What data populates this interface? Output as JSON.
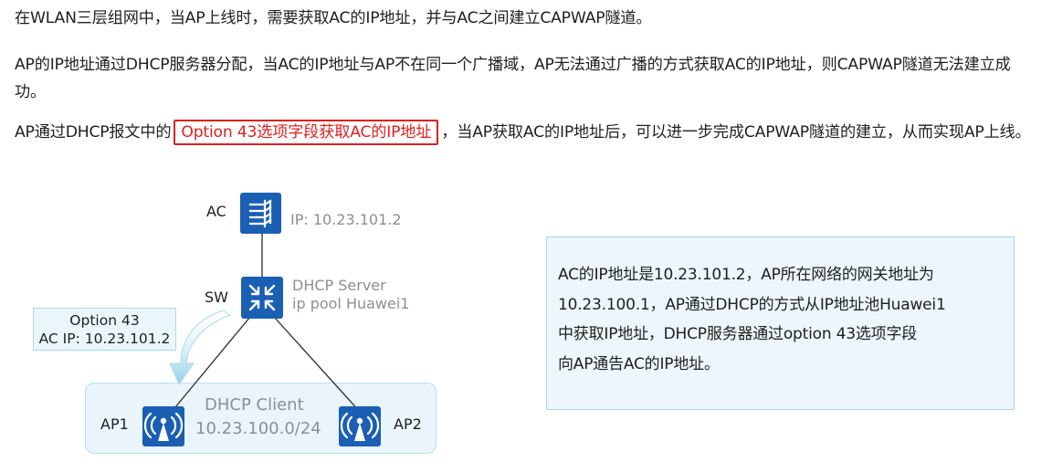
{
  "paragraphs": {
    "p1": "在WLAN三层组网中，当AP上线时，需要获取AC的IP地址，并与AC之间建立CAPWAP隧道。",
    "p2": "AP的IP地址通过DHCP服务器分配，当AC的IP地址与AP不在同一个广播域，AP无法通过广播的方式获取AC的IP地址，则CAPWAP隧道无法建立成功。",
    "p3_before": "AP通过DHCP报文中的",
    "p3_highlight": "Option 43选项字段获取AC的IP地址",
    "p3_after": "，当AP获取AC的IP地址后，可以进一步完成CAPWAP隧道的建立，从而实现AP上线。"
  },
  "diagram": {
    "ac": {
      "label": "AC",
      "ip": "IP: 10.23.101.2",
      "icon": "access-controller-icon"
    },
    "sw": {
      "label": "SW",
      "line1": "DHCP Server",
      "line2": "ip pool Huawei1",
      "icon": "switch-icon"
    },
    "option_box": {
      "line1": "Option 43",
      "line2": "AC IP: 10.23.101.2"
    },
    "client": {
      "line1": "DHCP Client",
      "line2": "10.23.100.0/24"
    },
    "ap1": {
      "label": "AP1",
      "icon": "wireless-ap-icon"
    },
    "ap2": {
      "label": "AP2",
      "icon": "wireless-ap-icon"
    }
  },
  "info_box": {
    "lines": [
      "AC的IP地址是10.23.101.2，AP所在网络的网关地址为",
      "10.23.100.1，AP通过DHCP的方式从IP地址池Huawei1",
      "中获取IP地址，DHCP服务器通过option 43选项字段",
      "向AP通告AC的IP地址。"
    ]
  },
  "colors": {
    "icon_blue": "#1a5fb4",
    "highlight_red": "#e02020",
    "box_fill": "#e9f5fb",
    "box_border": "#a7dcec",
    "label_gray": "#8a8f95"
  }
}
